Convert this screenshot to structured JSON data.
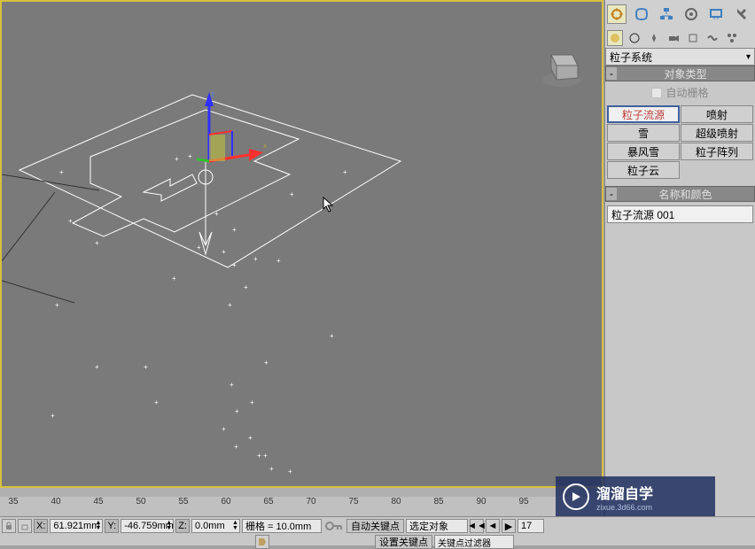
{
  "panel": {
    "dropdown": "粒子系统",
    "rollout1": {
      "title": "对象类型",
      "toggle": "-",
      "autogrid": "自动栅格",
      "buttons": {
        "pf_source": "粒子流源",
        "spray": "喷射",
        "snow": "雪",
        "super_spray": "超级喷射",
        "blizzard": "暴风雪",
        "p_array": "粒子阵列",
        "p_cloud": "粒子云"
      }
    },
    "rollout2": {
      "title": "名称和颜色",
      "toggle": "-",
      "name_value": "粒子流源 001"
    }
  },
  "status": {
    "x": "61.921mm",
    "y": "-46.759mm",
    "z": "0.0mm",
    "grid": "栅格 = 10.0mm",
    "auto_key": "自动关键点",
    "set_key": "设置关键点",
    "selected_object": "选定对象",
    "key_filter": "关键点过滤器",
    "frame": "17"
  },
  "timeline": {
    "ticks": [
      35,
      40,
      45,
      50,
      55,
      60,
      65,
      70,
      75,
      80,
      85,
      90,
      95
    ]
  },
  "watermark": {
    "main": "溜溜自学",
    "sub": "zixue.3d66.com"
  }
}
